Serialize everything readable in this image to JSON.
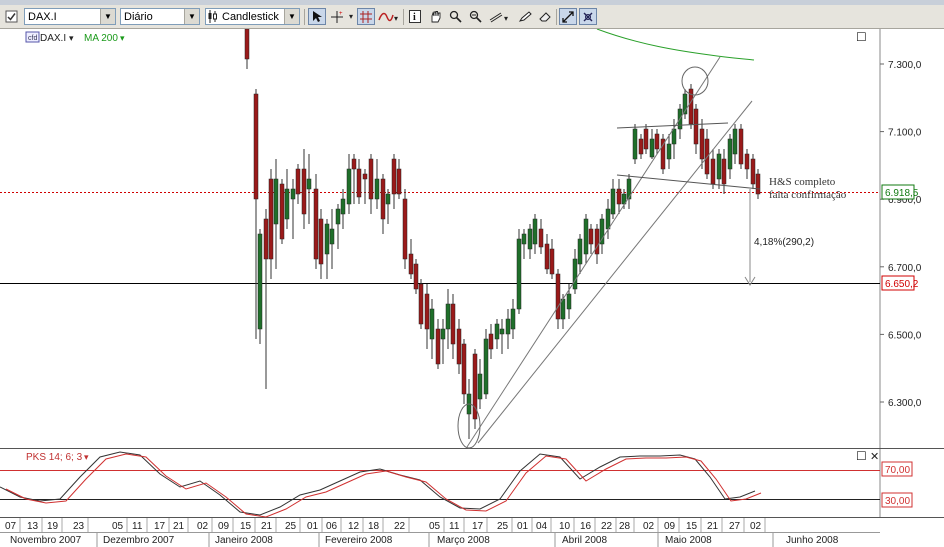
{
  "toolbar": {
    "symbol_value": "DAX.I",
    "period_value": "Diário",
    "charttype_value": "Candlestick",
    "icons": [
      "checkbox-icon",
      "chart-type-icon",
      "cursor-icon",
      "crosshair-icon",
      "grid-icon",
      "indicator-icon",
      "info-icon",
      "hand-icon",
      "zoom-icon",
      "zoom-out-icon",
      "lines-icon",
      "pencil-icon",
      "eraser-icon",
      "color-icon",
      "arrows-icon",
      "magnet-icon"
    ]
  },
  "legend": {
    "symbol": "DAX.I",
    "dropdown_arrow": "▾",
    "ma": "MA 200",
    "ma_color": "#1a9a1a"
  },
  "price_markers": {
    "last": "6.918,5",
    "last_color": "#117a11",
    "target": "6.650,2",
    "target_color": "#d00000"
  },
  "annotations": {
    "pattern_line1": "H&S completo",
    "pattern_line2": "falta confirmação",
    "move": "4,18%(290,2)"
  },
  "oscillator": {
    "label": "PKS 14; 6; 3",
    "upper": "70,00",
    "lower": "30,00",
    "line_color_fast": "#333333",
    "line_color_slow": "#d03030"
  },
  "panel_icons": {
    "maximize_main": "☐",
    "maximize_osc": "☐",
    "close_osc": "✕"
  },
  "chart_data": {
    "type": "candlestick",
    "title": "",
    "symbol": "DAX.I",
    "y_ticks": [
      "7.300,0",
      "7.100,0",
      "6.900,0",
      "6.700,0",
      "6.500,0",
      "6.300,0"
    ],
    "y_tick_values": [
      7300,
      7100,
      6900,
      6700,
      6500,
      6300
    ],
    "ylim": [
      6175,
      7415
    ],
    "day_ticks": [
      "07",
      "13",
      "19",
      "23",
      "05",
      "11",
      "17",
      "21",
      "02",
      "09",
      "15",
      "21",
      "25",
      "01",
      "06",
      "12",
      "18",
      "22",
      "05",
      "11",
      "17",
      "25",
      "01",
      "04",
      "10",
      "16",
      "22",
      "28",
      "02",
      "09",
      "15",
      "21",
      "27",
      "02"
    ],
    "month_labels": [
      "Novembro 2007",
      "Dezembro 2007",
      "Janeiro 2008",
      "Fevereiro 2008",
      "Março 2008",
      "Abril 2008",
      "Maio 2008",
      "Junho 2008"
    ],
    "horizontal_lines": [
      {
        "value": 6918.5,
        "style": "dotted",
        "color": "#d00000"
      },
      {
        "value": 6650.2,
        "style": "solid",
        "color": "#000000"
      }
    ],
    "ma200_visible": true,
    "oscillator_levels": [
      70,
      30
    ],
    "grid": false
  }
}
